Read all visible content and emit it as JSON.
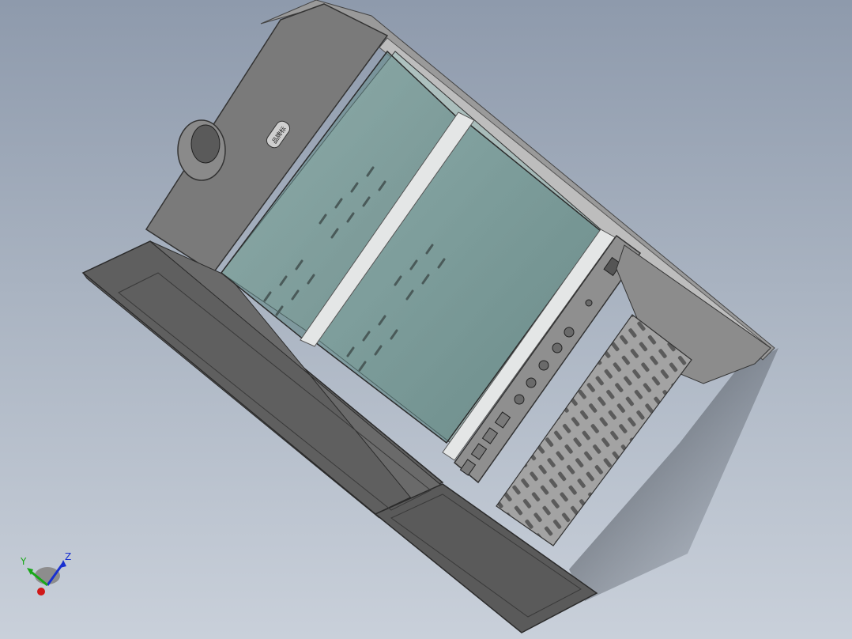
{
  "viewport": {
    "background_top": "#8e9aac",
    "background_bottom": "#c9d0da"
  },
  "model": {
    "body_color": "#6e6e6e",
    "glass_color": "#5e8a88",
    "frame_color": "#e4e6e6",
    "perforated_panel_color": "#9a9a9a",
    "badge_text": "品牌标"
  },
  "triad": {
    "x_label": "",
    "y_label": "Y",
    "z_label": "Z",
    "x_color": "#d01818",
    "y_color": "#18a818",
    "z_color": "#1830d0"
  }
}
